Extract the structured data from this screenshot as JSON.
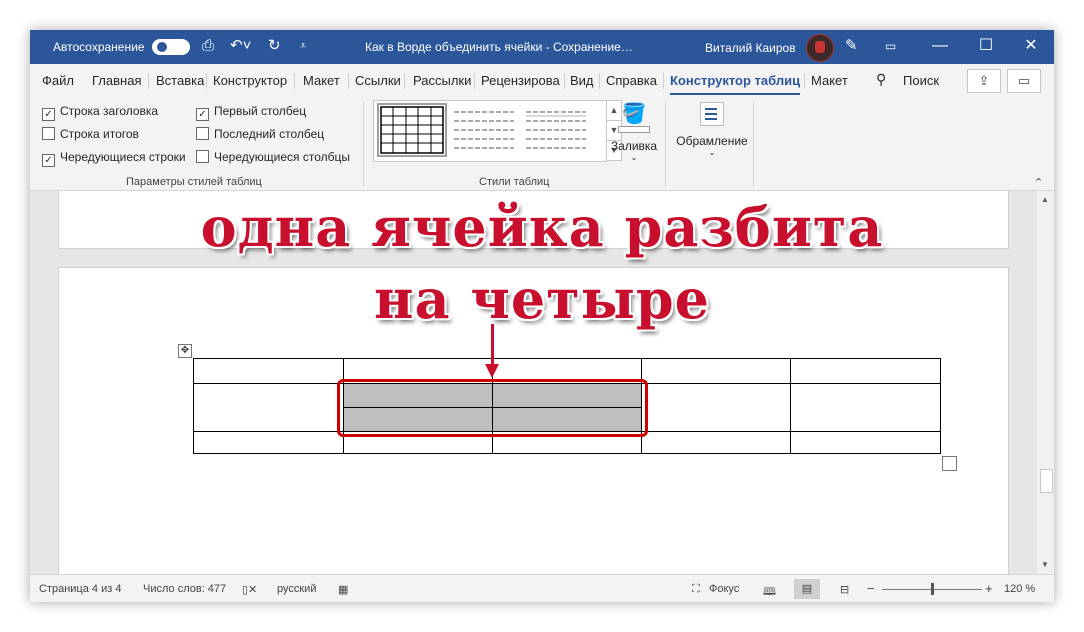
{
  "titlebar": {
    "autosave_label": "Автосохранение",
    "autosave_state": "on",
    "doc_title": "Как в Ворде объединить ячейки  -  Сохранение…",
    "user_name": "Виталий Каиров",
    "minimize_glyph": "—",
    "restore_glyph": "☐",
    "close_glyph": "✕"
  },
  "tabs": [
    "Файл",
    "Главная",
    "Вставка",
    "Конструктор",
    "Макет",
    "Ссылки",
    "Рассылки",
    "Рецензирова",
    "Вид",
    "Справка",
    "Конструктор таблиц",
    "Макет"
  ],
  "active_tab": "Конструктор таблиц",
  "search_label": "Поиск",
  "ribbon": {
    "options": [
      {
        "label": "Строка заголовка",
        "checked": true
      },
      {
        "label": "Строка итогов",
        "checked": false
      },
      {
        "label": "Чередующиеся строки",
        "checked": true
      },
      {
        "label": "Первый столбец",
        "checked": true
      },
      {
        "label": "Последний столбец",
        "checked": false
      },
      {
        "label": "Чередующиеся столбцы",
        "checked": false
      }
    ],
    "group1_label": "Параметры стилей таблиц",
    "group2_label": "Стили таблиц",
    "shading_label": "Заливка",
    "borders_label": "Обрамление"
  },
  "overlay": {
    "line1": "одна ячейка разбита",
    "line2": "на четыре"
  },
  "status": {
    "page": "Страница 4 из 4",
    "words": "Число слов: 477",
    "language": "русский",
    "focus": "Фокус",
    "zoom": "120 %",
    "zoom_fraction": 0.5
  },
  "colors": {
    "accent": "#2b579a",
    "annotation": "#c8102e",
    "merged_cell_fill": "#bfbfbf"
  }
}
